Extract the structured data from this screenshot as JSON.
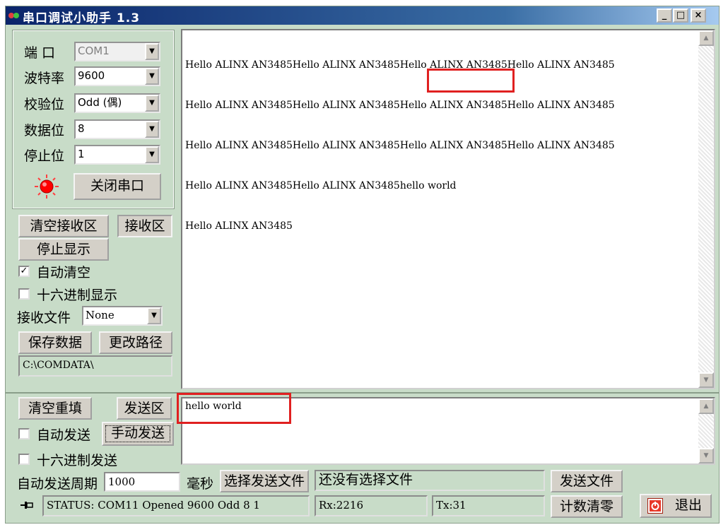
{
  "window": {
    "title": "串口调试小助手 1.3",
    "buttons": {
      "minimize": "_",
      "maximize": "□",
      "close": "×"
    }
  },
  "port_settings": {
    "port_label": "端  口",
    "port_value": "COM1",
    "baud_label": "波特率",
    "baud_value": "9600",
    "parity_label": "校验位",
    "parity_value": "Odd  (偶)",
    "databits_label": "数据位",
    "databits_value": "8",
    "stopbits_label": "停止位",
    "stopbits_value": "1",
    "close_port_button": "关闭串口"
  },
  "receive_panel": {
    "clear_button": "清空接收区",
    "area_label": "接收区",
    "stop_display_button": "停止显示",
    "auto_clear_label": "自动清空",
    "auto_clear_checked": true,
    "auto_clear_mark": "✓",
    "hex_display_label": "十六进制显示",
    "hex_display_checked": false,
    "file_label": "接收文件",
    "file_value": "None",
    "save_button": "保存数据",
    "change_path_button": "更改路径",
    "path": "C:\\COMDATA\\"
  },
  "receive_text": {
    "lines": [
      "Hello ALINX AN3485Hello ALINX AN3485Hello ALINX AN3485Hello ALINX AN3485",
      "Hello ALINX AN3485Hello ALINX AN3485Hello ALINX AN3485Hello ALINX AN3485",
      "Hello ALINX AN3485Hello ALINX AN3485Hello ALINX AN3485Hello ALINX AN3485",
      "Hello ALINX AN3485Hello ALINX AN3485hello world",
      "Hello ALINX AN3485"
    ]
  },
  "send_panel": {
    "clear_button": "清空重填",
    "area_label": "发送区",
    "auto_send_label": "自动发送",
    "auto_send_checked": false,
    "manual_send_button": "手动发送",
    "hex_send_label": "十六进制发送",
    "hex_send_checked": false,
    "period_label": "自动发送周期",
    "period_value": "1000",
    "period_unit": "毫秒",
    "choose_file_button": "选择发送文件",
    "file_status": "还没有选择文件",
    "send_file_button": "发送文件"
  },
  "send_text": {
    "value": "hello world"
  },
  "status_bar": {
    "status_text": "STATUS: COM11 Opened 9600 Odd   8 1",
    "rx": "Rx:2216",
    "tx": "Tx:31",
    "reset_count_button": "计数清零",
    "exit_button": "退出"
  },
  "colors": {
    "panel_bg": "#c8dcc8",
    "title_bar": "#0a246a",
    "highlight": "#e02020",
    "led": "#ff0000"
  }
}
